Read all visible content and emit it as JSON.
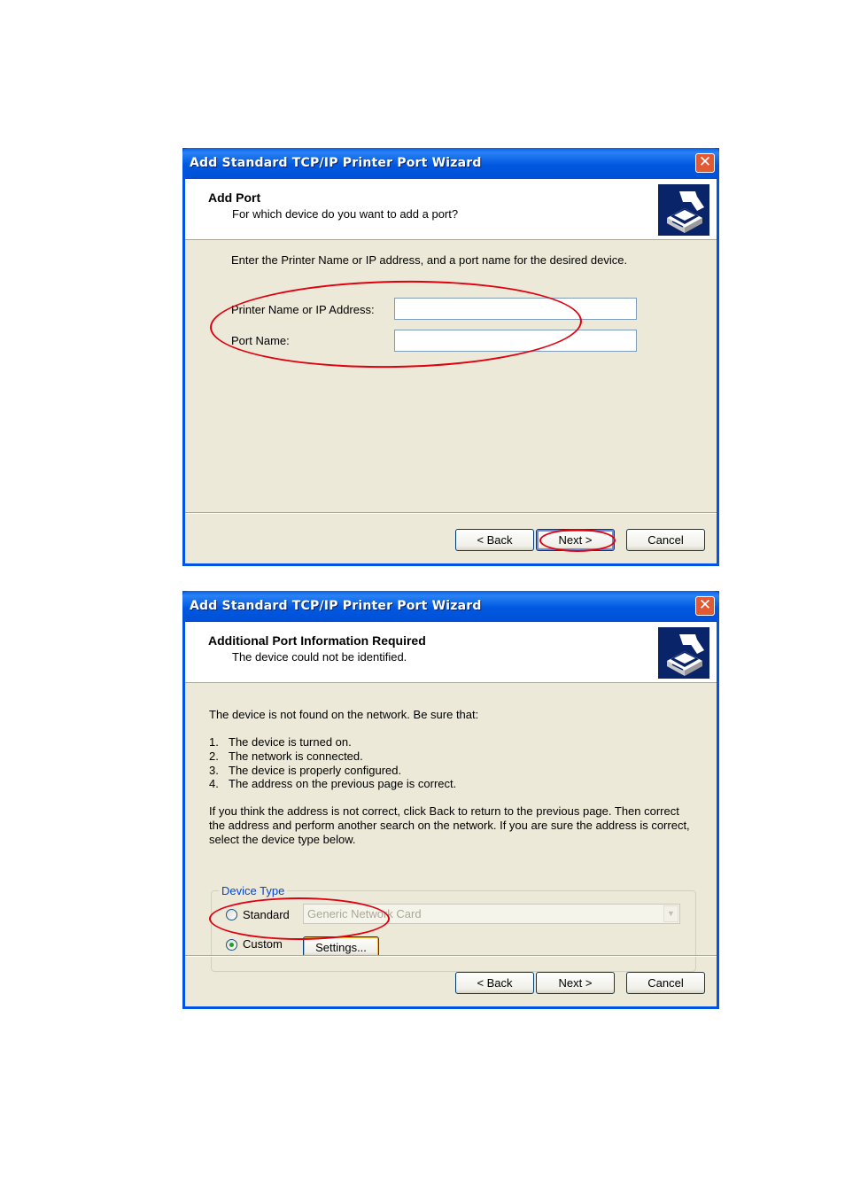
{
  "dialog1": {
    "title": "Add Standard TCP/IP Printer Port Wizard",
    "close_glyph": "✕",
    "header_title": "Add Port",
    "header_subtitle": "For which device do you want to add a port?",
    "instruction": "Enter the Printer Name or IP address, and a port name for the desired device.",
    "printer_name_label": "Printer Name or IP Address:",
    "printer_name_value": "",
    "port_name_label": "Port Name:",
    "port_name_value": "",
    "back_label": "< Back",
    "next_label": "Next >",
    "cancel_label": "Cancel"
  },
  "dialog2": {
    "title": "Add Standard TCP/IP Printer Port Wizard",
    "close_glyph": "✕",
    "header_title": "Additional Port Information Required",
    "header_subtitle": "The device could not be identified.",
    "intro": "The device is not found on the network.  Be sure that:",
    "checklist": [
      {
        "num": "1.",
        "text": "The device is turned on."
      },
      {
        "num": "2.",
        "text": "The network is connected."
      },
      {
        "num": "3.",
        "text": "The device is properly configured."
      },
      {
        "num": "4.",
        "text": "The address on the previous page is correct."
      }
    ],
    "note_lines": [
      "If you think the address is not correct, click Back to return to the previous page.  Then correct",
      "the address and perform another search on the network.  If you are sure the address is correct,",
      "select the device type below."
    ],
    "device_type_legend": "Device Type",
    "standard_label": "Standard",
    "standard_checked": false,
    "standard_select_value": "Generic Network Card",
    "custom_label": "Custom",
    "custom_checked": true,
    "settings_label": "Settings...",
    "back_label": "< Back",
    "next_label": "Next >",
    "cancel_label": "Cancel"
  },
  "colors": {
    "title_bar": "#0058e0",
    "dialog_face": "#ece9d8",
    "annotation_red": "#e0000f",
    "legend_blue": "#0046d5"
  },
  "icons": {
    "wizard_header": "printer-port-icon",
    "close": "close-icon",
    "dropdown": "chevron-down-icon"
  }
}
